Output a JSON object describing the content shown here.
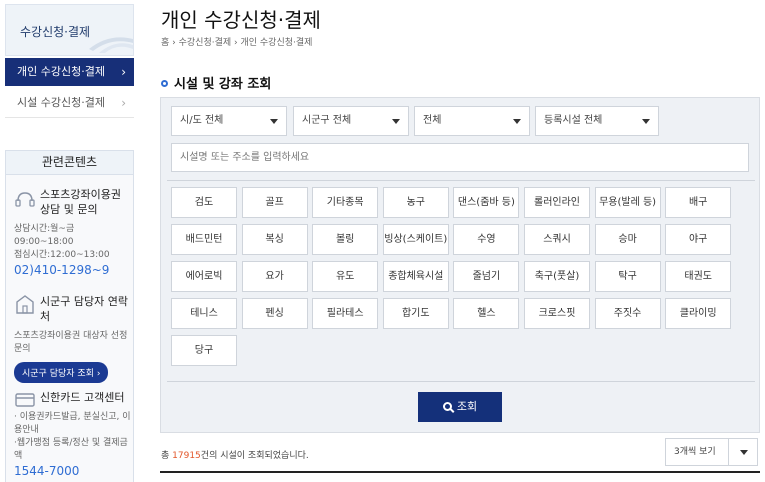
{
  "sidebar": {
    "header_title": "수강신청·결제",
    "active_item": "개인 수강신청·결제",
    "item2": "시설 수강신청·결제",
    "related": {
      "heading": "관련콘텐츠",
      "block1": {
        "title": "스포츠강좌이용권 상담 및 문의",
        "hours1": "상담시간:월~금 09:00~18:00",
        "hours2": "점심시간:12:00~13:00",
        "phone": "02)410-1298~9"
      },
      "block2": {
        "title": "시군구 담당자 연락처",
        "desc": "스포츠강좌이용권 대상자 선정 문의",
        "button": "시군구 담당자 조회"
      },
      "block3": {
        "title": "신한카드 고객센터",
        "desc1": "· 이용권카드발급, 분실신고, 이용안내",
        "desc2": "·웹가맹점 등록/정산 및 결제금액",
        "phone": "1544-7000"
      }
    }
  },
  "main": {
    "page_title": "개인 수강신청·결제",
    "breadcrumb": "홈 › 수강신청·결제 › 개인 수강신청·결제",
    "section_title": "시설 및 강좌 조회",
    "filters": {
      "sido": "시/도 전체",
      "sigungu": "시군구 전체",
      "all": "전체",
      "facility": "등록시설 전체"
    },
    "search_placeholder": "시설명 또는 주소를 입력하세요",
    "sports": [
      "검도",
      "골프",
      "기타종목",
      "농구",
      "댄스(줌바 등)",
      "롤러인라인",
      "무용(발레 등)",
      "배구",
      "배드민턴",
      "복싱",
      "볼링",
      "빙상(스케이트)",
      "수영",
      "스쿼시",
      "승마",
      "야구",
      "에어로빅",
      "요가",
      "유도",
      "종합체육시설",
      "줄넘기",
      "축구(풋살)",
      "탁구",
      "태권도",
      "테니스",
      "펜싱",
      "필라테스",
      "합기도",
      "헬스",
      "크로스핏",
      "주짓수",
      "클라이밍",
      "당구"
    ],
    "search_button": "조회",
    "result_prefix": "총 ",
    "result_count": "17915",
    "result_suffix": "건의 시설이 조회되었습니다.",
    "view_option": "3개씩 보기"
  }
}
